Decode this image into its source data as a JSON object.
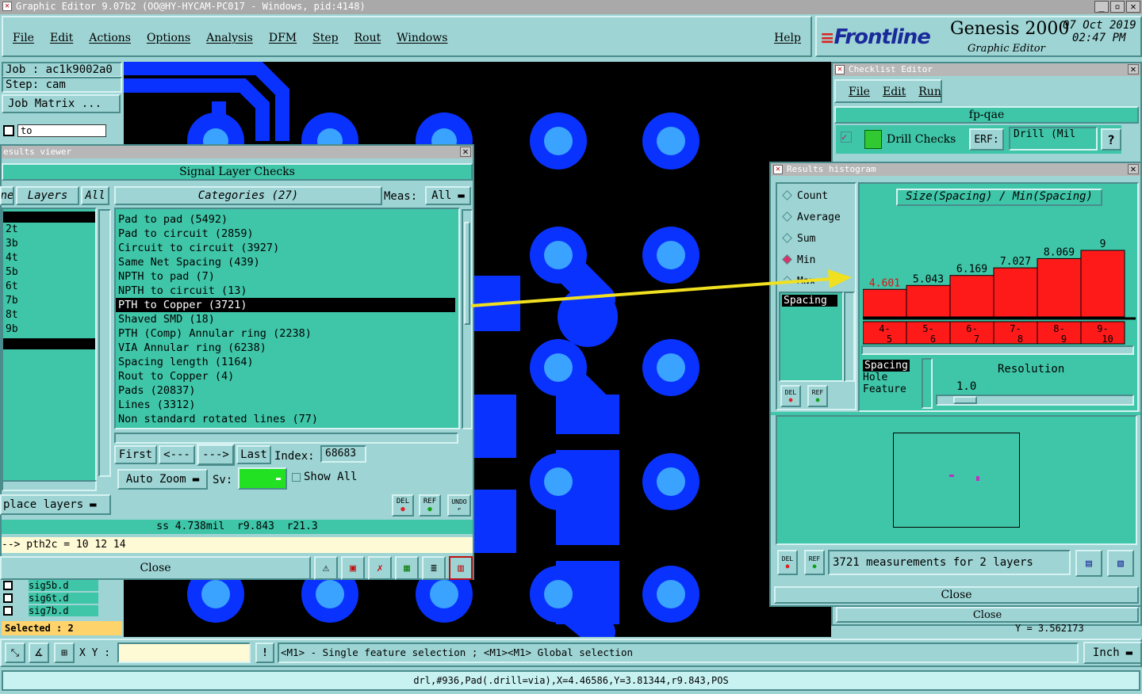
{
  "app": {
    "title": "Graphic Editor 9.07b2 (OO@HY-HYCAM-PC017 - Windows, pid:4148)"
  },
  "menu": [
    "File",
    "Edit",
    "Actions",
    "Options",
    "Analysis",
    "DFM",
    "Step",
    "Rout",
    "Windows"
  ],
  "help": "Help",
  "brand": {
    "logo": "Frontline",
    "product": "Genesis 2000",
    "subtitle": "Graphic Editor",
    "date": "07 Oct 2019",
    "time": "02:47 PM"
  },
  "job": {
    "job": "Job : ac1k9002a0",
    "step": "Step: cam",
    "matrix": "Job Matrix ...",
    "to": "to",
    "selected": "Selected : 2"
  },
  "layers_bottom": [
    "sig5b.d",
    "sig6t.d",
    "sig7b.d"
  ],
  "results": {
    "title": "esults viewer",
    "heading": "Signal Layer Checks",
    "ne": "ne",
    "layers_btn": "Layers",
    "all_btn": "All",
    "categories": "Categories (27)",
    "meas_label": "Meas:",
    "meas_value": "All",
    "layer_items": [
      "",
      "2t",
      "3b",
      "4t",
      "5b",
      "6t",
      "7b",
      "8t",
      "9b",
      ""
    ],
    "category_items": [
      "Pad to pad (5492)",
      "Pad to circuit (2859)",
      "Circuit to circuit (3927)",
      "Same Net Spacing (439)",
      "NPTH to pad (7)",
      "NPTH to circuit (13)",
      "PTH to Copper (3721)",
      "Shaved SMD (18)",
      "PTH (Comp) Annular ring (2238)",
      "VIA Annular ring (6238)",
      "Spacing length (1164)",
      "Rout to Copper (4)",
      "Pads (20837)",
      "Lines (3312)",
      "Non standard rotated lines (77)"
    ],
    "first": "First",
    "prev": "<---",
    "next": "--->",
    "last": "Last",
    "index_label": "Index:",
    "index_value": "68683",
    "auto_zoom": "Auto Zoom",
    "sv": "Sv:",
    "show_all": "Show All",
    "replace": "place layers",
    "del": "DEL",
    "ref": "REF",
    "undo": "UNDO",
    "measure": "ss 4.738mil  r9.843  r21.3",
    "pth": "--> pth2c = 10 12 14",
    "close": "Close"
  },
  "checklist": {
    "title": "Checklist Editor",
    "menu": [
      "File",
      "Edit",
      "Run"
    ],
    "name": "fp-qae",
    "drill": "Drill Checks",
    "erf": "ERF:",
    "erf_value": "Drill (Mil",
    "help": "?",
    "close": "Close",
    "y_readout": "Y = 3.562173"
  },
  "histogram": {
    "title": "Results histogram",
    "options": [
      "Count",
      "Average",
      "Sum",
      "Min",
      "Max"
    ],
    "selected_option": "Min",
    "spacing": "Spacing",
    "heading": "Size(Spacing) / Min(Spacing)",
    "resolution_label": "Resolution",
    "resolution": "1.0",
    "axis_list": [
      "Spacing",
      "Hole",
      "Feature"
    ],
    "summary": "3721 measurements for 2 layers",
    "close": "Close",
    "del": "DEL",
    "ref": "REF"
  },
  "chart_data": {
    "type": "bar",
    "title": "Size(Spacing) / Min(Spacing)",
    "categories": [
      "4-5",
      "5-6",
      "6-7",
      "7-8",
      "8-9",
      "9-10"
    ],
    "values": [
      4.601,
      5.043,
      6.169,
      7.027,
      8.069,
      9
    ],
    "value_labels": [
      "4.601",
      "5.043",
      "6.169",
      "7.027",
      "8.069",
      "9"
    ],
    "bar_color": "#ff1a1a",
    "ylim": [
      0,
      10
    ]
  },
  "status": {
    "xy_label": "X Y :",
    "info": "<M1> - Single feature selection ; <M1><M1> Global selection",
    "unit": "Inch",
    "bottom": "drl,#936,Pad(.drill=via),X=4.46586,Y=3.81344,r9.843,POS"
  }
}
